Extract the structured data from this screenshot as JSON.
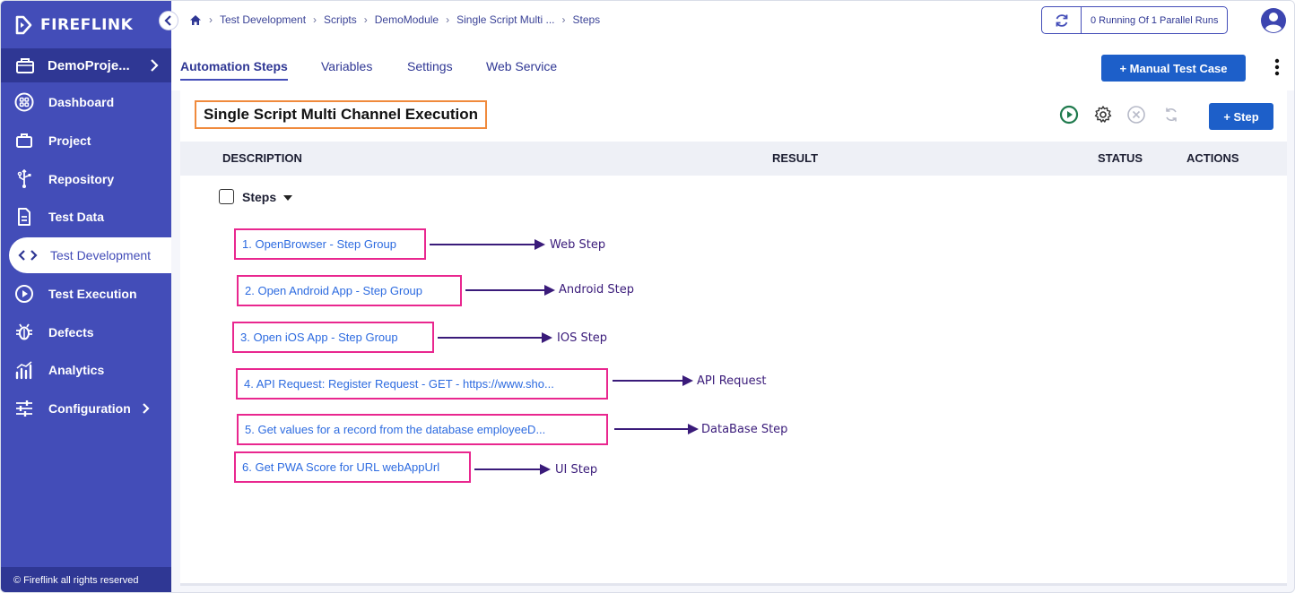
{
  "app": {
    "name": "FIREFLINK"
  },
  "sidebar": {
    "project": "DemoProje...",
    "items": [
      {
        "label": "Dashboard",
        "icon": "dashboard-icon"
      },
      {
        "label": "Project",
        "icon": "briefcase-icon"
      },
      {
        "label": "Repository",
        "icon": "repository-icon"
      },
      {
        "label": "Test Data",
        "icon": "document-icon"
      },
      {
        "label": "Test Development",
        "icon": "code-icon"
      },
      {
        "label": "Test Execution",
        "icon": "play-circle-icon"
      },
      {
        "label": "Defects",
        "icon": "bug-icon"
      },
      {
        "label": "Analytics",
        "icon": "analytics-icon"
      },
      {
        "label": "Configuration",
        "icon": "sliders-icon"
      }
    ],
    "active": "Test Development",
    "footer": "© Fireflink all rights reserved"
  },
  "breadcrumb": [
    "Test Development",
    "Scripts",
    "DemoModule",
    "Single Script Multi ...",
    "Steps"
  ],
  "runs": {
    "label": "0 Running Of 1 Parallel Runs"
  },
  "tabs": [
    {
      "label": "Automation Steps",
      "active": true
    },
    {
      "label": "Variables",
      "active": false
    },
    {
      "label": "Settings",
      "active": false
    },
    {
      "label": "Web Service",
      "active": false
    }
  ],
  "buttons": {
    "manual_test_case": "+ Manual Test Case",
    "add_step": "+ Step"
  },
  "script": {
    "title": "Single Script Multi Channel Execution"
  },
  "table": {
    "columns": {
      "description": "DESCRIPTION",
      "result": "RESULT",
      "status": "STATUS",
      "actions": "ACTIONS"
    }
  },
  "steps_group": {
    "label": "Steps"
  },
  "steps": [
    {
      "label": "1. OpenBrowser - Step Group",
      "annotation": "Web Step"
    },
    {
      "label": "2. Open Android App - Step Group",
      "annotation": "Android Step"
    },
    {
      "label": "3. Open iOS App - Step Group",
      "annotation": "IOS Step"
    },
    {
      "label": "4. API Request: Register Request - GET - https://www.sho...",
      "annotation": "API Request"
    },
    {
      "label": "5. Get values for a record from the database employeeD...",
      "annotation": "DataBase Step"
    },
    {
      "label": "6. Get PWA Score for URL webAppUrl",
      "annotation": "UI Step"
    }
  ],
  "colors": {
    "sidebar": "#434db8",
    "primary_button": "#1d5fc9",
    "highlight_step": "#e9278f",
    "highlight_title": "#f08a3c",
    "annotation": "#3a1b7a"
  }
}
